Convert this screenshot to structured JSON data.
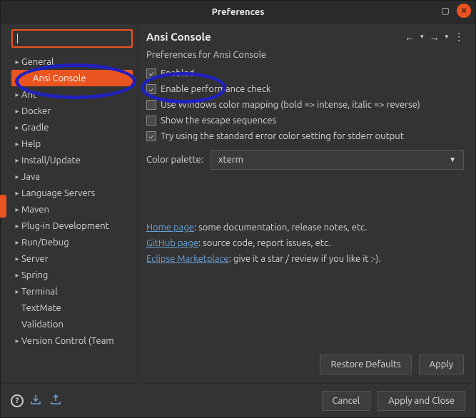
{
  "window": {
    "title": "Preferences"
  },
  "sidebar": {
    "search_value": "",
    "items": [
      {
        "label": "General",
        "expandable": true
      },
      {
        "label": "Ansi Console",
        "expandable": false,
        "selected": true,
        "child": true
      },
      {
        "label": "Ant",
        "expandable": true
      },
      {
        "label": "Docker",
        "expandable": true
      },
      {
        "label": "Gradle",
        "expandable": true
      },
      {
        "label": "Help",
        "expandable": true
      },
      {
        "label": "Install/Update",
        "expandable": true
      },
      {
        "label": "Java",
        "expandable": true
      },
      {
        "label": "Language Servers",
        "expandable": true
      },
      {
        "label": "Maven",
        "expandable": true
      },
      {
        "label": "Plug-in Development",
        "expandable": true
      },
      {
        "label": "Run/Debug",
        "expandable": true
      },
      {
        "label": "Server",
        "expandable": true
      },
      {
        "label": "Spring",
        "expandable": true
      },
      {
        "label": "Terminal",
        "expandable": true
      },
      {
        "label": "TextMate",
        "expandable": false
      },
      {
        "label": "Validation",
        "expandable": false
      },
      {
        "label": "Version Control (Team",
        "expandable": true
      }
    ]
  },
  "content": {
    "title": "Ansi Console",
    "section_title": "Preferences for Ansi Console",
    "options": [
      {
        "label": "Enabled",
        "checked": true
      },
      {
        "label": "Enable performance check",
        "checked": true
      },
      {
        "label": "Use Windows color mapping (bold => intense, italic => reverse)",
        "checked": false
      },
      {
        "label": "Show the escape sequences",
        "checked": false
      },
      {
        "label": "Try using the standard error color setting for stderr output",
        "checked": true
      }
    ],
    "palette_label": "Color palette:",
    "palette_value": "xterm",
    "links": {
      "home": {
        "text": "Home page",
        "suffix": ": some documentation, release notes, etc."
      },
      "github": {
        "text": "GitHub page",
        "suffix": ": source code, report issues, etc."
      },
      "marketplace": {
        "text": "Eclipse Marketplace",
        "suffix": ": give it a star / review if you like it :-)."
      }
    },
    "restore": "Restore Defaults",
    "apply": "Apply"
  },
  "footer": {
    "cancel": "Cancel",
    "apply_close": "Apply and Close"
  }
}
